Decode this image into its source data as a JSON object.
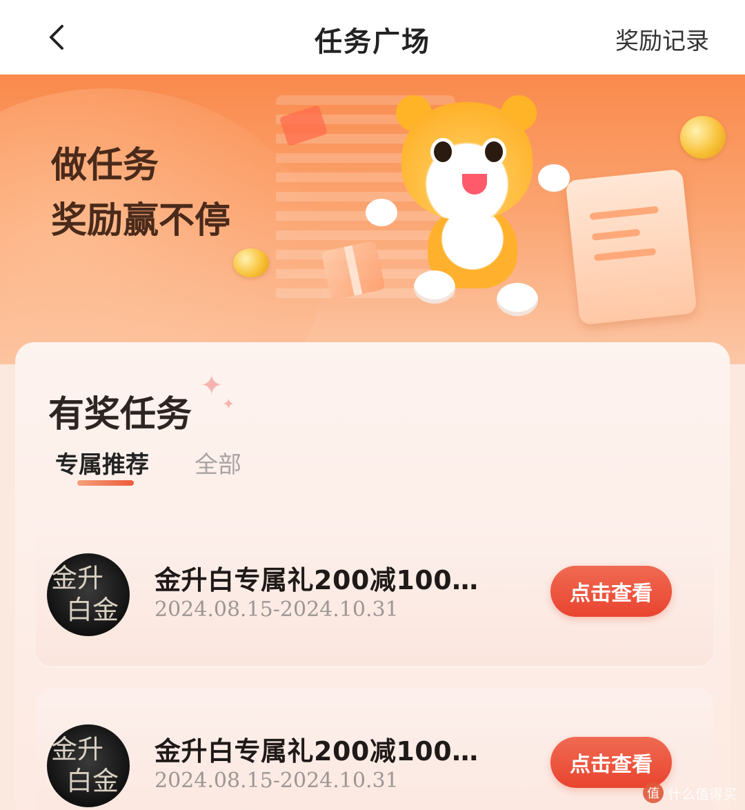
{
  "navbar": {
    "title": "任务广场",
    "right_label": "奖励记录"
  },
  "hero": {
    "line1": "做任务",
    "line2": "奖励赢不停"
  },
  "panel": {
    "title": "有奖任务",
    "tabs": [
      {
        "label": "专属推荐",
        "active": true
      },
      {
        "label": "全部",
        "active": false
      }
    ]
  },
  "tasks": [
    {
      "avatar_text_1": "金升",
      "avatar_text_2": "白金",
      "title": "金升白专属礼200减100…",
      "date": "2024.08.15-2024.10.31",
      "button_label": "点击查看"
    },
    {
      "avatar_text_1": "金升",
      "avatar_text_2": "白金",
      "title": "金升白专属礼200减100…",
      "date": "2024.08.15-2024.10.31",
      "button_label": "点击查看"
    }
  ],
  "watermark": {
    "icon_text": "值",
    "text": "什么值得买"
  },
  "colors": {
    "accent": "#e9442f",
    "hero_top": "#f98a4c"
  }
}
